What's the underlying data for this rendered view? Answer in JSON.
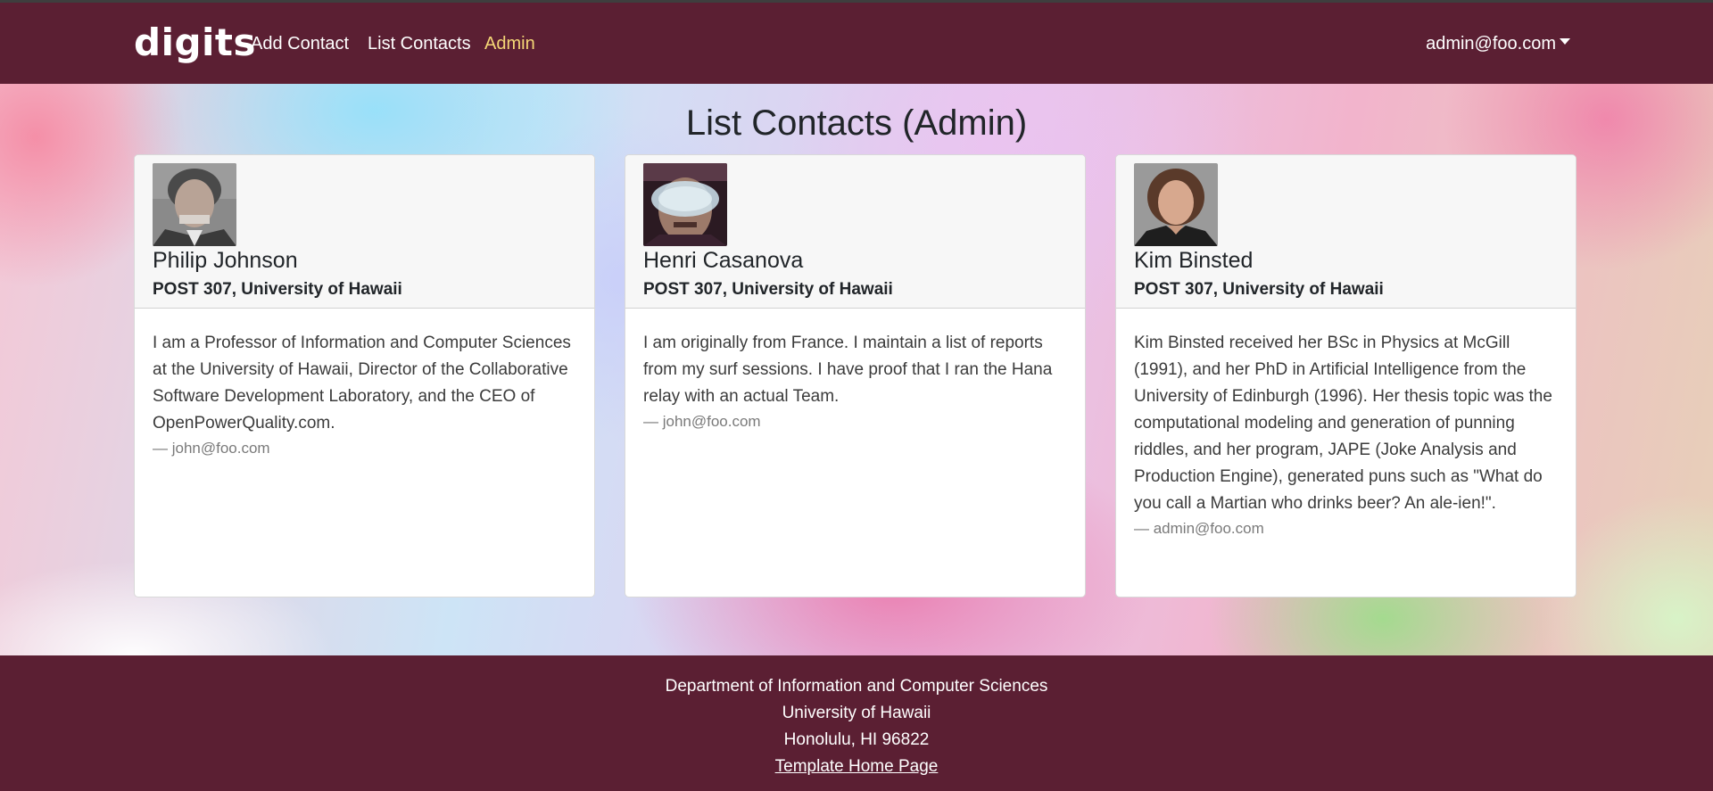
{
  "navbar": {
    "brand": "digits",
    "links": [
      {
        "label": "Add Contact"
      },
      {
        "label": "List Contacts"
      },
      {
        "label": "Admin"
      }
    ],
    "user": "admin@foo.com",
    "active_color": "#f5d776"
  },
  "main": {
    "title": "List Contacts (Admin)",
    "contacts": [
      {
        "name": "Philip Johnson",
        "address": "POST 307, University of Hawaii",
        "description": "I am a Professor of Information and Computer Sciences at the University of Hawaii, Director of the Collaborative Software Development Laboratory, and the CEO of OpenPowerQuality.com.",
        "owner": "— john@foo.com"
      },
      {
        "name": "Henri Casanova",
        "address": "POST 307, University of Hawaii",
        "description": "I am originally from France. I maintain a list of reports from my surf sessions. I have proof that I ran the Hana relay with an actual Team.",
        "owner": "— john@foo.com"
      },
      {
        "name": "Kim Binsted",
        "address": "POST 307, University of Hawaii",
        "description": "Kim Binsted received her BSc in Physics at McGill (1991), and her PhD in Artificial Intelligence from the University of Edinburgh (1996). Her thesis topic was the computational modeling and generation of punning riddles, and her program, JAPE (Joke Analysis and Production Engine), generated puns such as \"What do you call a Martian who drinks beer? An ale-ien!\".",
        "owner": "— admin@foo.com"
      }
    ]
  },
  "footer": {
    "line1": "Department of Information and Computer Sciences",
    "line2": "University of Hawaii",
    "line3": "Honolulu, HI 96822",
    "link": "Template Home Page"
  },
  "colors": {
    "brand_bg": "#5b1f33",
    "text": "#212529"
  }
}
